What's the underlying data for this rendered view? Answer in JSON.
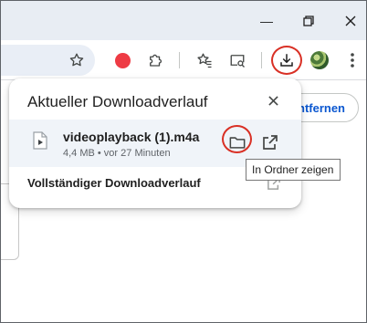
{
  "window": {
    "minimize_glyph": "—",
    "restore_glyph": "❐",
    "close_glyph": "✕"
  },
  "toolbar": {
    "icons": [
      "bookmark-star-icon",
      "record-extension-icon",
      "extensions-puzzle-icon",
      "favorites-icon",
      "search-tab-icon",
      "download-icon",
      "profile-avatar",
      "more-menu-icon"
    ],
    "download_highlighted": true,
    "highlight_color": "#d93025"
  },
  "background": {
    "button_partial_label": "ntfernen"
  },
  "download_bubble": {
    "title": "Aktueller Downloadverlauf",
    "items": [
      {
        "file_name": "videoplayback (1).m4a",
        "meta": "4,4 MB • vor 27 Minuten"
      }
    ],
    "full_history_label": "Vollständiger Downloadverlauf"
  },
  "tooltip": {
    "text": "In Ordner zeigen"
  },
  "colors": {
    "titlebar": "#e8edf3",
    "row_background": "#f0f4f9",
    "accent": "#0b57d0",
    "record": "#ee3b44"
  }
}
